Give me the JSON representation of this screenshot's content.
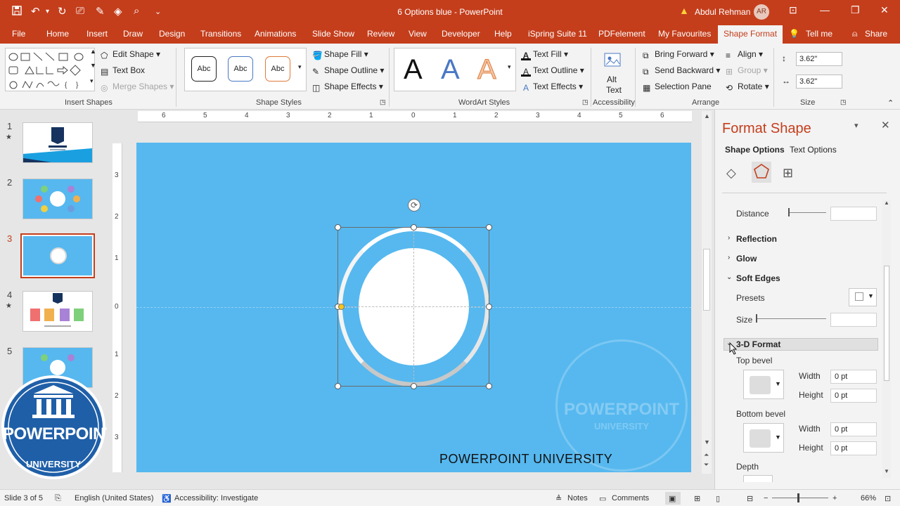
{
  "titlebar": {
    "doc_title": "6 Options blue  -  PowerPoint",
    "user_name": "Abdul Rehman",
    "avatar_initials": "AR"
  },
  "tabs": [
    "File",
    "Home",
    "Insert",
    "Draw",
    "Design",
    "Transitions",
    "Animations",
    "Slide Show",
    "Review",
    "View",
    "Developer",
    "Help",
    "iSpring Suite 11",
    "PDFelement",
    "My Favourites",
    "Shape Format"
  ],
  "active_tab": "Shape Format",
  "tell_me": "Tell me",
  "share": "Share",
  "ribbon": {
    "insert_shapes": {
      "edit_shape": "Edit Shape",
      "text_box": "Text Box",
      "merge_shapes": "Merge Shapes",
      "label": "Insert Shapes"
    },
    "shape_styles": {
      "swatch_text": "Abc",
      "shape_fill": "Shape Fill",
      "shape_outline": "Shape Outline",
      "shape_effects": "Shape Effects",
      "label": "Shape Styles"
    },
    "wordart": {
      "letter": "A",
      "text_fill": "Text Fill",
      "text_outline": "Text Outline",
      "text_effects": "Text Effects",
      "label": "WordArt Styles"
    },
    "accessibility": {
      "alt_text_1": "Alt",
      "alt_text_2": "Text",
      "label": "Accessibility"
    },
    "arrange": {
      "bring_forward": "Bring Forward",
      "send_backward": "Send Backward",
      "selection_pane": "Selection Pane",
      "align": "Align",
      "group": "Group",
      "rotate": "Rotate",
      "label": "Arrange"
    },
    "size": {
      "height": "3.62\"",
      "width": "3.62\"",
      "label": "Size"
    }
  },
  "slides": [
    {
      "num": "1",
      "star": "★"
    },
    {
      "num": "2",
      "star": ""
    },
    {
      "num": "3",
      "star": ""
    },
    {
      "num": "4",
      "star": "★"
    },
    {
      "num": "5",
      "star": ""
    }
  ],
  "ruler": {
    "h": [
      "6",
      "5",
      "4",
      "3",
      "2",
      "1",
      "0",
      "1",
      "2",
      "3",
      "4",
      "5",
      "6"
    ],
    "v": [
      "3",
      "2",
      "1",
      "0",
      "1",
      "2",
      "3"
    ]
  },
  "slide": {
    "footer_text": "POWERPOINT UNIVERSITY",
    "watermark_text": "POWERPOINT",
    "watermark_sub": "UNIVERSITY"
  },
  "logo": {
    "text": "POWERPOINT",
    "sub": "UNIVERSITY"
  },
  "format_pane": {
    "title": "Format Shape",
    "tab_shape_options": "Shape Options",
    "tab_text_options": "Text Options",
    "distance_label": "Distance",
    "reflection": "Reflection",
    "glow": "Glow",
    "soft_edges": "Soft Edges",
    "presets_label": "Presets",
    "size_label": "Size",
    "three_d_format": "3-D Format",
    "top_bevel": "Top bevel",
    "bottom_bevel": "Bottom bevel",
    "width_label": "Width",
    "height_label": "Height",
    "top_width": "0 pt",
    "top_height": "0 pt",
    "bottom_width": "0 pt",
    "bottom_height": "0 pt",
    "depth_label": "Depth"
  },
  "status": {
    "slide_info": "Slide 3 of 5",
    "language": "English (United States)",
    "accessibility": "Accessibility: Investigate",
    "notes": "Notes",
    "comments": "Comments",
    "zoom": "66%"
  },
  "colors": {
    "brand": "#c43e1c",
    "slide_bg": "#56b8ef"
  }
}
